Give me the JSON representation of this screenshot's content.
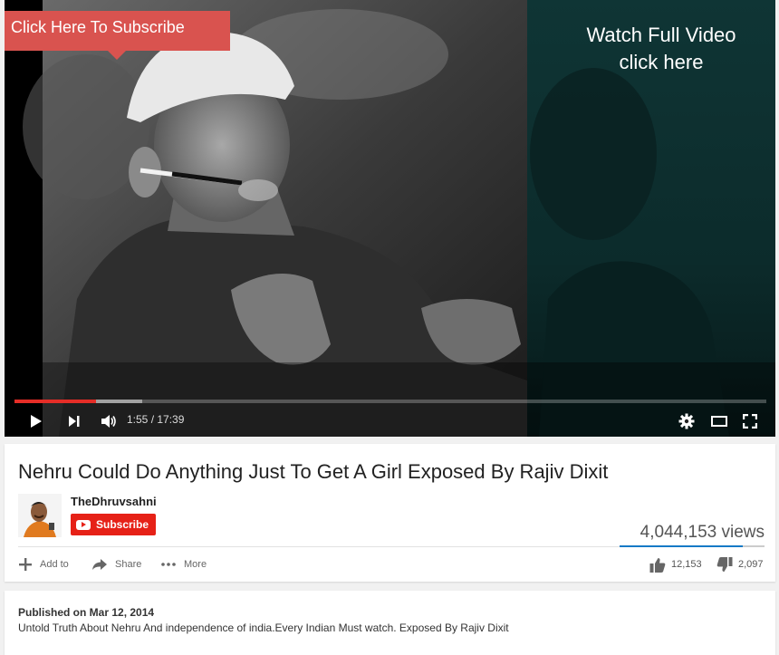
{
  "player": {
    "annotation_subscribe": "Click Here To Subscribe",
    "annotation_watch_line1": "Watch Full Video",
    "annotation_watch_line2": "click here",
    "current_time": "1:55",
    "duration": "17:39",
    "played_fraction": 0.109,
    "loaded_fraction": 0.17
  },
  "video": {
    "title": "Nehru Could Do Anything Just To Get A Girl Exposed By Rajiv Dixit",
    "views": "4,044,153 views",
    "like_ratio": 0.853
  },
  "channel": {
    "name": "TheDhruvsahni",
    "subscribe_label": "Subscribe"
  },
  "actions": {
    "add_to": "Add to",
    "share": "Share",
    "more": "More"
  },
  "ratings": {
    "likes": "12,153",
    "dislikes": "2,097"
  },
  "description": {
    "published": "Published on Mar 12, 2014",
    "text": "Untold Truth About Nehru And independence of india.Every Indian Must watch. Exposed By Rajiv Dixit"
  },
  "colors": {
    "progress_played": "#e52d27",
    "subscribe": "#e62117",
    "like_bar": "#167ac6",
    "annotation": "#d9534f"
  }
}
